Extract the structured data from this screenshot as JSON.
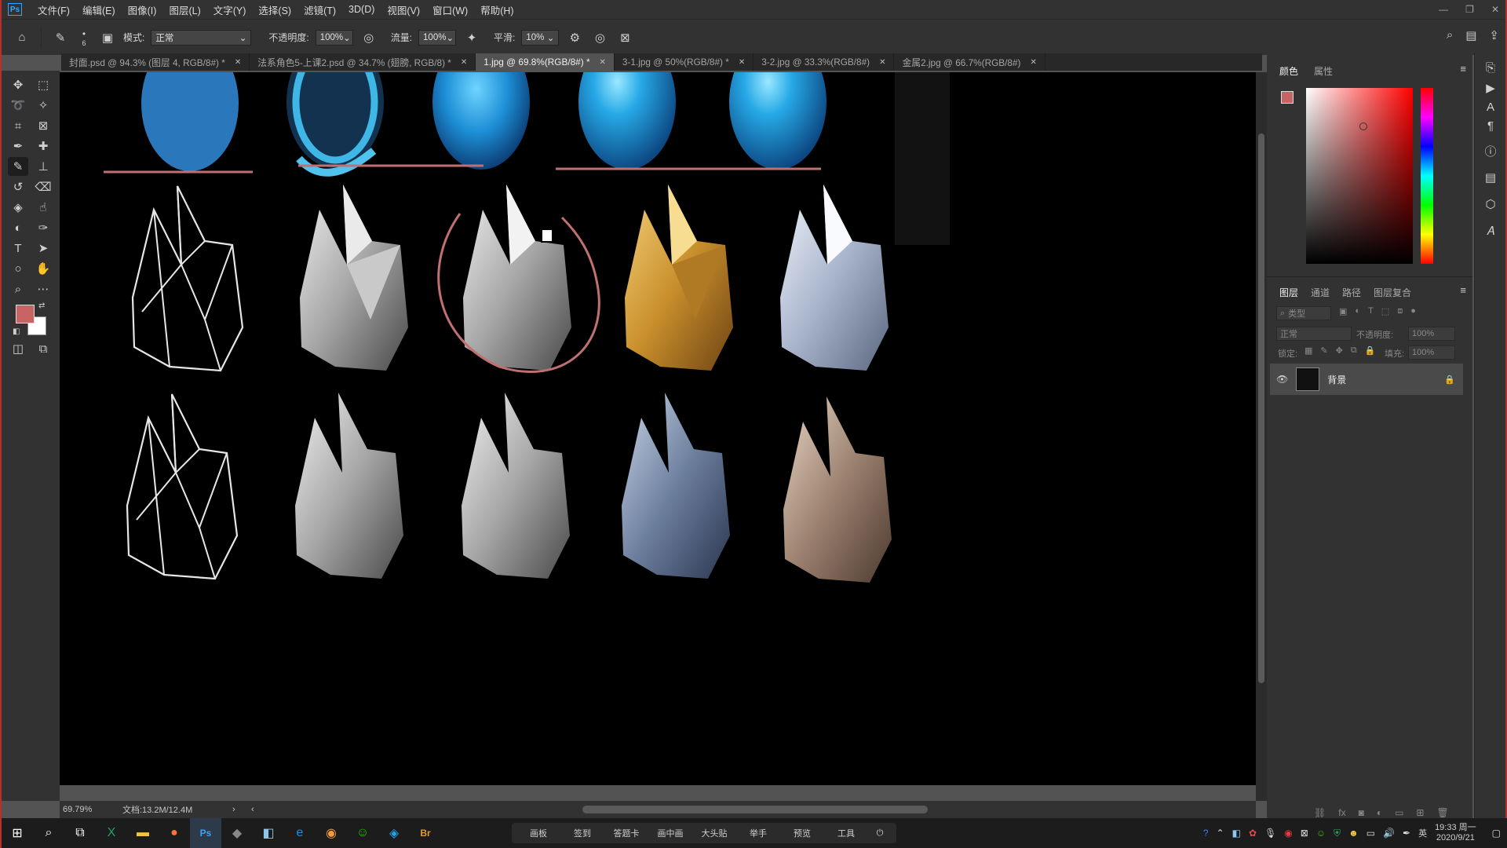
{
  "app": {
    "logo": "Ps"
  },
  "menu": [
    "文件(F)",
    "编辑(E)",
    "图像(I)",
    "图层(L)",
    "文字(Y)",
    "选择(S)",
    "滤镜(T)",
    "3D(D)",
    "视图(V)",
    "窗口(W)",
    "帮助(H)"
  ],
  "options": {
    "brush_size": "6",
    "mode_label": "模式:",
    "mode_value": "正常",
    "opacity_label": "不透明度:",
    "opacity_value": "100%",
    "flow_label": "流量:",
    "flow_value": "100%",
    "smooth_label": "平滑:",
    "smooth_value": "10%"
  },
  "tabs": [
    {
      "label": "封面.psd @ 94.3% (图层 4, RGB/8#) *",
      "active": false
    },
    {
      "label": "法系角色5-上课2.psd @ 34.7% (翅膀, RGB/8) *",
      "active": false
    },
    {
      "label": "1.jpg @ 69.8%(RGB/8#) *",
      "active": true
    },
    {
      "label": "3-1.jpg @ 50%(RGB/8#) *",
      "active": false
    },
    {
      "label": "3-2.jpg @ 33.3%(RGB/8#)",
      "active": false
    },
    {
      "label": "金属2.jpg @ 66.7%(RGB/8#)",
      "active": false
    }
  ],
  "status": {
    "zoom": "69.79%",
    "doc": "文档:13.2M/12.4M"
  },
  "color_panel": {
    "tabs": [
      "颜色",
      "属性"
    ],
    "foreground": "#c86464",
    "background": "#ffffff"
  },
  "layers_panel": {
    "tabs": [
      "图层",
      "通道",
      "路径",
      "图层复合"
    ],
    "filter_placeholder": "类型",
    "blend_mode": "正常",
    "opacity_label": "不透明度:",
    "opacity_value": "100%",
    "lock_label": "锁定:",
    "fill_label": "填充:",
    "fill_value": "100%",
    "layer_name": "背景"
  },
  "taskbar": {
    "quick_items": [
      "画板",
      "签到",
      "答题卡",
      "画中画",
      "大头贴",
      "举手",
      "预览",
      "工具"
    ],
    "ime": "英",
    "time": "19:33 周一",
    "date": "2020/9/21"
  }
}
